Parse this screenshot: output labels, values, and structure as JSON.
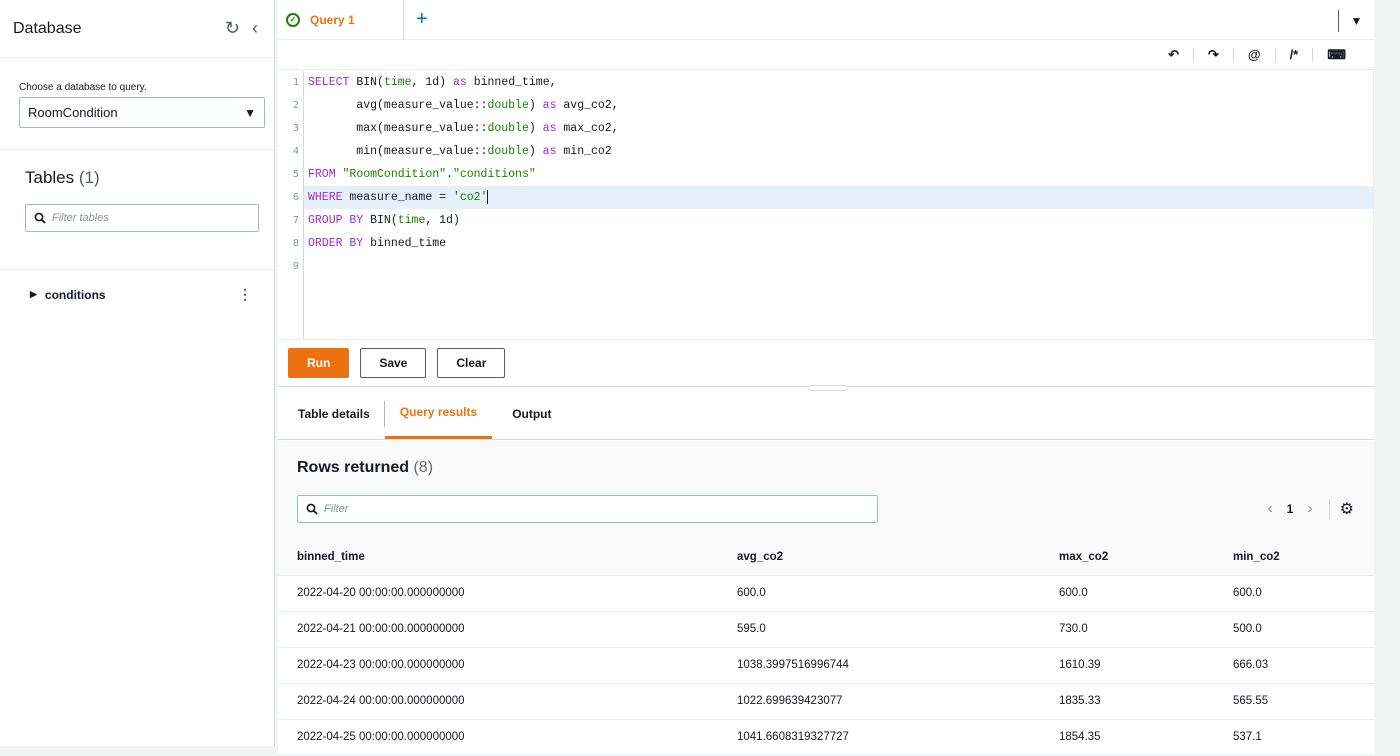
{
  "sidebar": {
    "title": "Database",
    "database_label": "Choose a database to query.",
    "database_value": "RoomCondition",
    "tables_title": "Tables",
    "tables_count": "(1)",
    "filter_placeholder": "Filter tables",
    "tree": [
      {
        "name": "conditions"
      }
    ]
  },
  "tabs": {
    "active_tab": "Query 1"
  },
  "toolbar": {
    "undo": "↶",
    "redo": "↷",
    "at": "@",
    "comment": "/*",
    "keyboard": "⌨"
  },
  "editor": {
    "lines": [
      {
        "num": "1"
      },
      {
        "num": "2"
      },
      {
        "num": "3"
      },
      {
        "num": "4"
      },
      {
        "num": "5"
      },
      {
        "num": "6"
      },
      {
        "num": "7"
      },
      {
        "num": "8"
      },
      {
        "num": "9"
      }
    ],
    "code": [
      [
        [
          "kw",
          "SELECT"
        ],
        [
          "fn",
          " BIN"
        ],
        [
          "p",
          "("
        ],
        [
          "ty",
          "time"
        ],
        [
          "p",
          ", "
        ],
        [
          "fn",
          "1d"
        ],
        [
          "p",
          ")"
        ],
        [
          "kw",
          " as"
        ],
        [
          "fn",
          " binned_time,"
        ]
      ],
      [
        [
          "fn",
          "       avg"
        ],
        [
          "p",
          "("
        ],
        [
          "fn",
          "measure_value::"
        ],
        [
          "ty",
          "double"
        ],
        [
          "p",
          ")"
        ],
        [
          "kw",
          " as"
        ],
        [
          "fn",
          " avg_co2,"
        ]
      ],
      [
        [
          "fn",
          "       max"
        ],
        [
          "p",
          "("
        ],
        [
          "fn",
          "measure_value::"
        ],
        [
          "ty",
          "double"
        ],
        [
          "p",
          ")"
        ],
        [
          "kw",
          " as"
        ],
        [
          "fn",
          " max_co2,"
        ]
      ],
      [
        [
          "fn",
          "       min"
        ],
        [
          "p",
          "("
        ],
        [
          "fn",
          "measure_value::"
        ],
        [
          "ty",
          "double"
        ],
        [
          "p",
          ")"
        ],
        [
          "kw",
          " as"
        ],
        [
          "fn",
          " min_co2"
        ]
      ],
      [
        [
          "kw",
          "FROM"
        ],
        [
          "st",
          " \"RoomCondition\""
        ],
        [
          "fn",
          "."
        ],
        [
          "st",
          "\"conditions\""
        ]
      ],
      [
        [
          "kw",
          "WHERE"
        ],
        [
          "fn",
          " measure_name = "
        ],
        [
          "st",
          "'co2'"
        ]
      ],
      [
        [
          "kw",
          "GROUP BY"
        ],
        [
          "fn",
          " BIN"
        ],
        [
          "p",
          "("
        ],
        [
          "ty",
          "time"
        ],
        [
          "p",
          ", "
        ],
        [
          "fn",
          "1d"
        ],
        [
          "p",
          ")"
        ]
      ],
      [
        [
          "kw",
          "ORDER BY"
        ],
        [
          "fn",
          " binned_time"
        ]
      ],
      []
    ]
  },
  "actions": {
    "run": "Run",
    "save": "Save",
    "clear": "Clear"
  },
  "result_tabs": [
    "Table details",
    "Query results",
    "Output"
  ],
  "results": {
    "title": "Rows returned",
    "count": "(8)",
    "filter_placeholder": "Filter",
    "page": "1",
    "columns": [
      "binned_time",
      "avg_co2",
      "max_co2",
      "min_co2"
    ],
    "rows": [
      [
        "2022-04-20 00:00:00.000000000",
        "600.0",
        "600.0",
        "600.0"
      ],
      [
        "2022-04-21 00:00:00.000000000",
        "595.0",
        "730.0",
        "500.0"
      ],
      [
        "2022-04-23 00:00:00.000000000",
        "1038.3997516996744",
        "1610.39",
        "666.03"
      ],
      [
        "2022-04-24 00:00:00.000000000",
        "1022.699639423077",
        "1835.33",
        "565.55"
      ],
      [
        "2022-04-25 00:00:00.000000000",
        "1041.6608319327727",
        "1854.35",
        "537.1"
      ]
    ]
  },
  "colors": {
    "accent": "#ec7211",
    "keyword": "#9f2bd6",
    "string": "#1d8102"
  }
}
